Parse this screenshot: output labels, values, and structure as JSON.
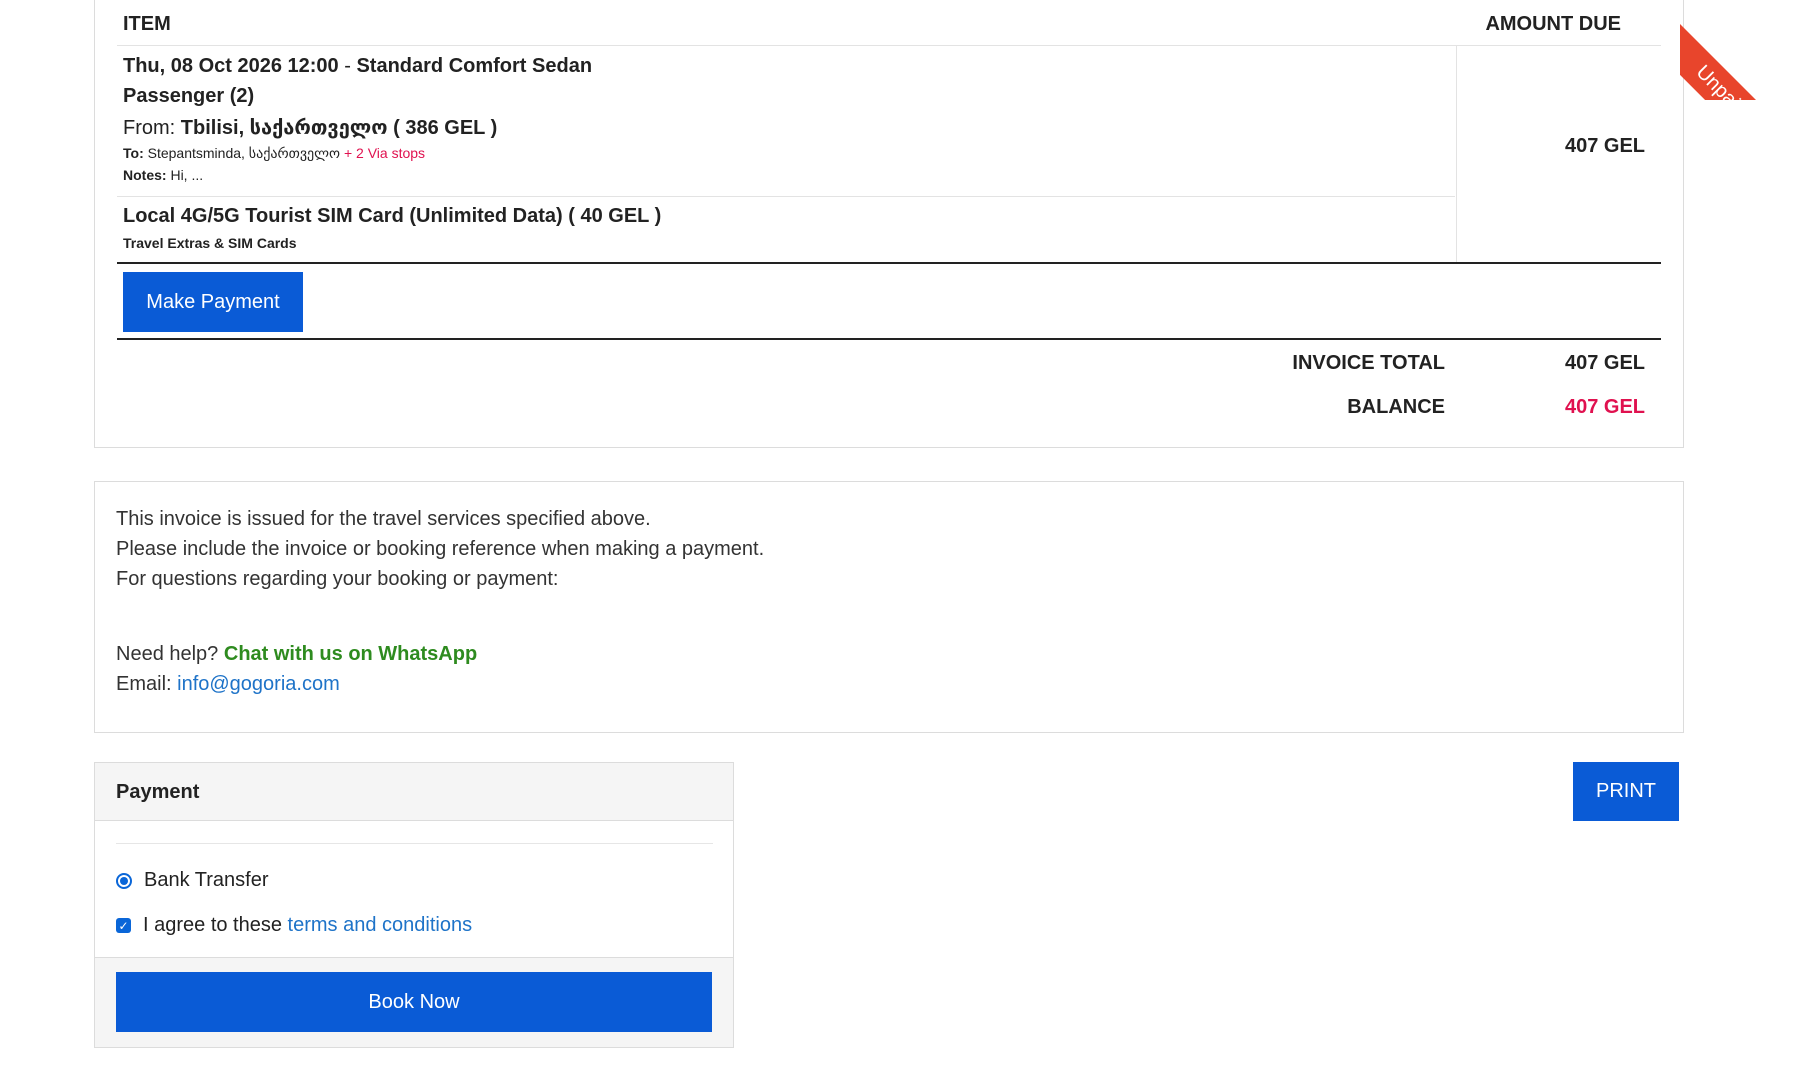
{
  "table": {
    "col_item": "ITEM",
    "col_amount": "AMOUNT DUE",
    "trip": {
      "datetime": "Thu, 08 Oct 2026 12:00",
      "separator": " - ",
      "vehicle": "Standard Comfort Sedan",
      "passengers": "Passenger (2)",
      "from_label": "From: ",
      "from_value": "Tbilisi, საქართველო ( 386 GEL )",
      "to_label": "To: ",
      "to_value": "Stepantsminda, საქართველო ",
      "via_stops": "+ 2 Via stops",
      "notes_label": "Notes: ",
      "notes_value": "Hi, ..."
    },
    "amount": "407 GEL",
    "extra": {
      "name": "Local 4G/5G Tourist SIM Card (Unlimited Data) ( 40 GEL )",
      "category": "Travel Extras & SIM Cards"
    },
    "make_payment_label": "Make Payment",
    "invoice_total_label": "INVOICE TOTAL",
    "invoice_total_value": "407 GEL",
    "balance_label": "BALANCE",
    "balance_value": "407 GEL"
  },
  "info": {
    "line1": "This invoice is issued for the travel services specified above.",
    "line2": "Please include the invoice or booking reference when making a payment.",
    "line3": "For questions regarding your booking or payment:",
    "help_label": "Need help? ",
    "whatsapp_link": "Chat with us on WhatsApp",
    "email_label": "Email: ",
    "email_value": "info@gogoria.com"
  },
  "payment": {
    "title": "Payment",
    "method": "Bank Transfer",
    "agree_text": "I agree to these ",
    "terms_link": "terms and conditions",
    "book_now_label": "Book Now"
  },
  "print_label": "PRINT",
  "ribbon_text": "Unpaid",
  "colors": {
    "primary_blue": "#0a5bd6",
    "balance_red": "#e0114f",
    "whatsapp_green": "#2e8b1f",
    "link_blue": "#1e73c8",
    "ribbon_red": "#e8452c"
  }
}
